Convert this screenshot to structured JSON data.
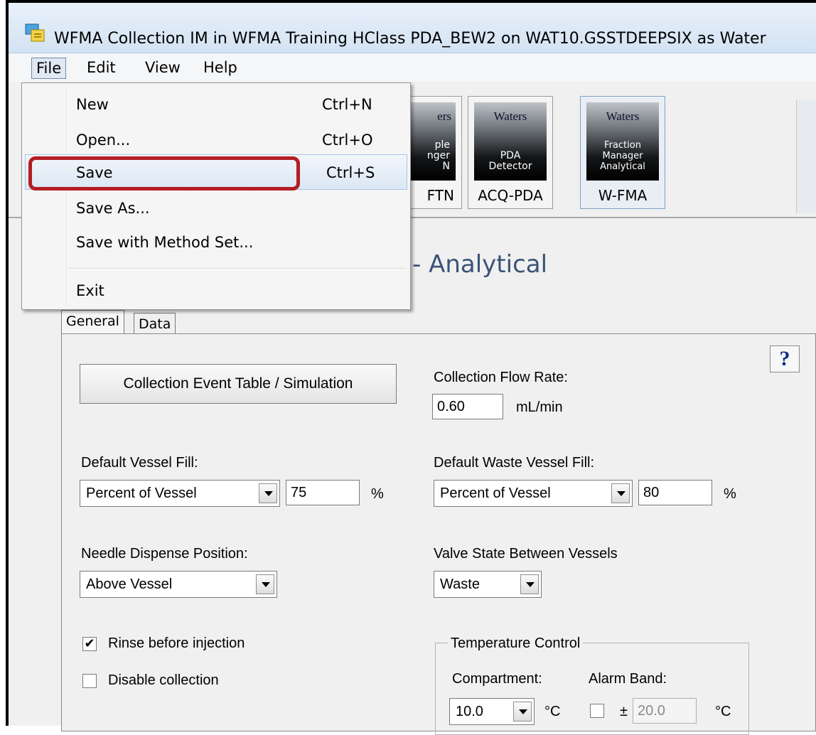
{
  "window": {
    "title": "WFMA Collection IM in WFMA Training HClass PDA_BEW2 on WAT10.GSSTDEEPSIX as Water"
  },
  "menubar": {
    "items": [
      {
        "label": "File"
      },
      {
        "label": "Edit"
      },
      {
        "label": "View"
      },
      {
        "label": "Help"
      }
    ]
  },
  "file_menu": {
    "items": [
      {
        "label": "New",
        "shortcut": "Ctrl+N"
      },
      {
        "label": "Open...",
        "shortcut": "Ctrl+O"
      },
      {
        "label": "Save",
        "shortcut": "Ctrl+S"
      },
      {
        "label": "Save As...",
        "shortcut": ""
      },
      {
        "label": "Save with Method Set...",
        "shortcut": ""
      },
      {
        "label": "Exit",
        "shortcut": ""
      }
    ],
    "highlighted": "Save"
  },
  "toolbar": {
    "buttons": [
      {
        "brand": "ers",
        "sub": "ple\nnger\nN",
        "caption": "FTN"
      },
      {
        "brand": "Waters",
        "sub": "PDA\nDetector",
        "caption": "ACQ-PDA"
      },
      {
        "brand": "Waters",
        "sub": "Fraction\nManager\nAnalytical",
        "caption": "W-FMA"
      }
    ]
  },
  "page": {
    "heading": "- Analytical"
  },
  "tabs": [
    {
      "label": "General"
    },
    {
      "label": "Data"
    }
  ],
  "form": {
    "help_label": "?",
    "event_table_button": "Collection Event Table / Simulation",
    "flow_rate_label": "Collection Flow Rate:",
    "flow_rate_value": "0.60",
    "flow_rate_unit": "mL/min",
    "vessel_fill_label": "Default Vessel Fill:",
    "vessel_fill_mode": "Percent of Vessel",
    "vessel_fill_value": "75",
    "vessel_fill_unit": "%",
    "waste_fill_label": "Default Waste Vessel Fill:",
    "waste_fill_mode": "Percent of Vessel",
    "waste_fill_value": "80",
    "waste_fill_unit": "%",
    "needle_label": "Needle Dispense Position:",
    "needle_value": "Above Vessel",
    "valve_label": "Valve State Between Vessels",
    "valve_value": "Waste",
    "rinse_label": "Rinse before injection",
    "rinse_checked": true,
    "disable_label": "Disable collection",
    "disable_checked": false,
    "temp_group_label": "Temperature Control",
    "compartment_label": "Compartment:",
    "compartment_value": "10.0",
    "compartment_unit": "°C",
    "alarm_label": "Alarm Band:",
    "alarm_pm": "±",
    "alarm_value": "20.0",
    "alarm_unit": "°C"
  },
  "colors": {
    "highlight_box": "#b41e24",
    "heading": "#3b5377"
  }
}
